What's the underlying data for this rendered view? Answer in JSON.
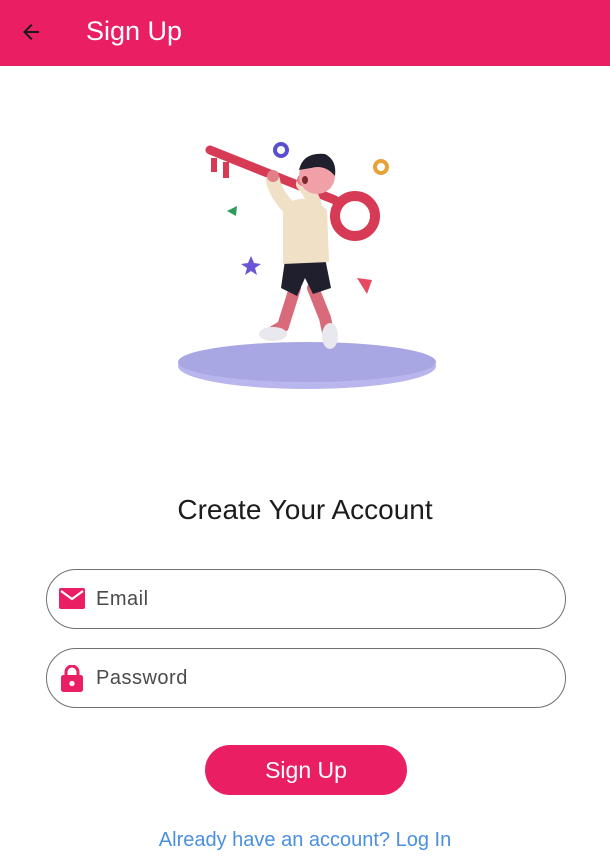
{
  "app_bar": {
    "title": "Sign Up",
    "back_icon": "arrow-back-icon",
    "color": "#e91e63"
  },
  "illustration": {
    "subject": "person-carrying-key-illustration"
  },
  "heading": "Create Your Account",
  "form": {
    "email": {
      "placeholder": "Email",
      "value": "",
      "icon": "mail-icon"
    },
    "password": {
      "placeholder": "Password",
      "value": "",
      "icon": "lock-icon"
    }
  },
  "signup_button": {
    "label": "Sign Up"
  },
  "login_link": {
    "text": "Already have an account? Log In",
    "color": "#4a8fe0"
  },
  "colors": {
    "accent": "#e91e63",
    "text": "#1c1c1c",
    "background": "#ffffff"
  }
}
